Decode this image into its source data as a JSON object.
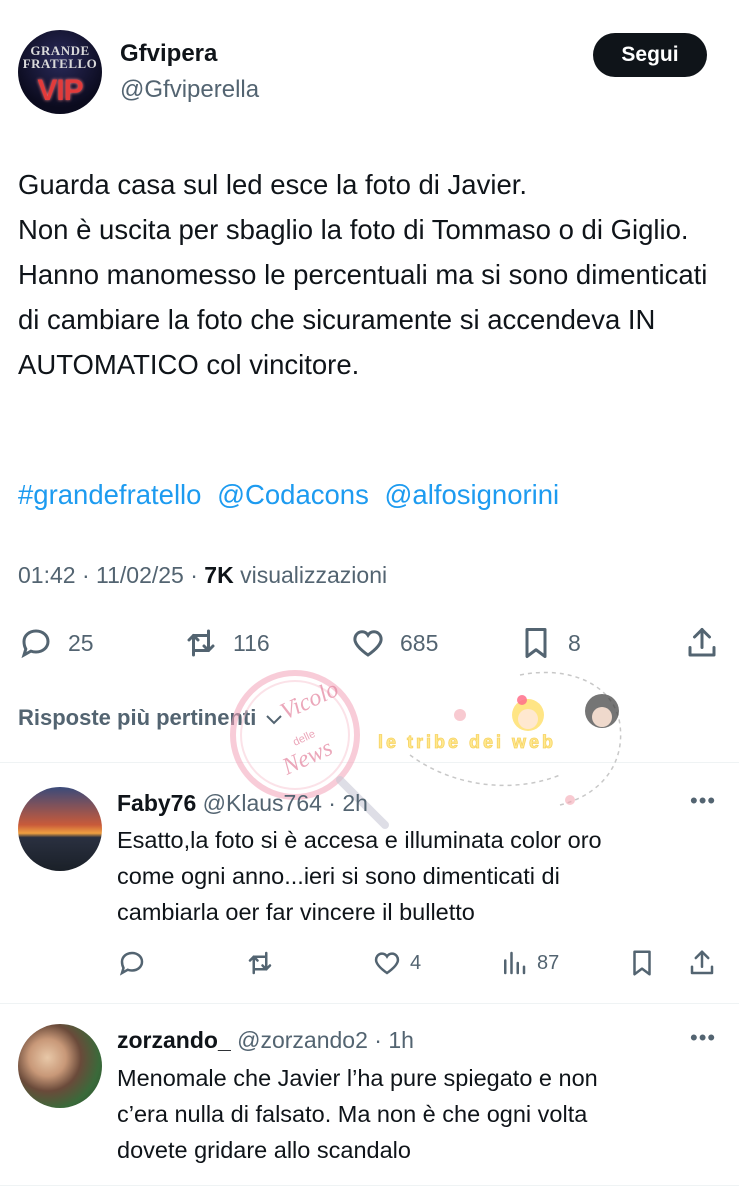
{
  "tweet": {
    "author_name": "Gfvipera",
    "author_handle": "@Gfviperella",
    "avatar_text_top": "GRANDE FRATELLO",
    "avatar_text_bottom": "VIP",
    "follow_label": "Segui",
    "text": "Guarda casa sul led esce la foto di Javier.\nNon è uscita per sbaglio la foto di Tommaso o di Giglio.\nHanno manomesso le percentuali ma si sono dimenticati di cambiare la foto che sicuramente si accendeva IN AUTOMATICO col vincitore.",
    "hashtags": [
      "#grandefratello",
      "@Codacons",
      "@alfosignorini"
    ],
    "time": "01:42",
    "date": "11/02/25",
    "views_count": "7K",
    "views_label": "visualizzazioni",
    "replies": "25",
    "reposts": "116",
    "likes": "685",
    "bookmarks": "8"
  },
  "replies_header": "Risposte più pertinenti",
  "watermark": {
    "left_text": [
      "Vicolo",
      "delle",
      "News"
    ],
    "right_text": "le tribe dei web"
  },
  "replies": [
    {
      "name": "Faby76",
      "handle": "@Klaus764",
      "time": "2h",
      "text": "Esatto,la foto si è accesa e illuminata color oro\ncome ogni anno...ieri si sono dimenticati di\ncambiarla oer far vincere il bulletto",
      "likes": "4",
      "views": "87"
    },
    {
      "name": "zorzando_",
      "handle": "@zorzando2",
      "time": "1h",
      "text": "Menomale che Javier l’ha pure spiegato e non\nc’era nulla di falsato. Ma non è che ogni volta\ndovete gridare allo scandalo"
    }
  ],
  "colors": {
    "text": "#0f1419",
    "secondary": "#536471",
    "link": "#1d9bf0",
    "divider": "#eff3f4"
  }
}
